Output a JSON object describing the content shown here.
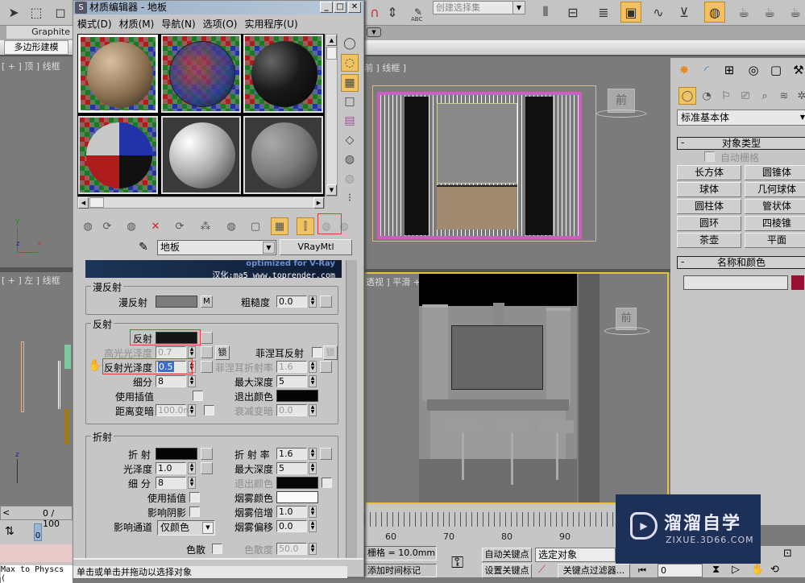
{
  "toolbar": {
    "selection_set_placeholder": "创建选择集",
    "graphite_tab": "Graphite",
    "poly_modeling_tab": "多边形建模",
    "abc_label": "ABC"
  },
  "viewports": {
    "top_label": "[ + ] 顶 ] 线框",
    "left_label": "[ + ] 左 ] 线框",
    "front_label": "前 ] 线框 ]",
    "perspective_label": "透视 ] 平滑 + 高光 ]",
    "viewcube_face": "前",
    "axis_x": "x",
    "axis_y": "y",
    "axis_z": "z"
  },
  "material_editor": {
    "title": "材质编辑器 - 地板",
    "menu": [
      "模式(D)",
      "材质(M)",
      "导航(N)",
      "选项(O)",
      "实用程序(U)"
    ],
    "material_name": "地板",
    "material_type": "VRayMtl",
    "banner_line1": "optimized for V-Ray",
    "banner_line2": "汉化:ma5 www.toprender.com",
    "diffuse": {
      "group_title": "漫反射",
      "diffuse_label": "漫反射",
      "diffuse_color": "#7c7c7c",
      "map_button": "M",
      "roughness_label": "粗糙度",
      "roughness_value": "0.0"
    },
    "reflection": {
      "group_title": "反射",
      "reflect_label": "反射",
      "reflect_color": "#161616",
      "hilight_gloss_label": "高光光泽度",
      "hilight_gloss_value": "0.7",
      "lock_button": "锁",
      "fresnel_label": "菲涅耳反射",
      "fresnel_lock": "锁",
      "refl_gloss_label": "反射光泽度",
      "refl_gloss_value": "0.5",
      "fresnel_ior_label": "菲涅耳折射率",
      "fresnel_ior_value": "1.6",
      "subdivs_label": "细分",
      "subdivs_value": "8",
      "max_depth_label": "最大深度",
      "max_depth_value": "5",
      "use_interp_label": "使用插值",
      "exit_color_label": "退出颜色",
      "exit_color": "#050505",
      "dim_distance_label": "距离变暗",
      "dim_distance_value": "100.0m",
      "dim_falloff_label": "衰减变暗",
      "dim_falloff_value": "0.0"
    },
    "refraction": {
      "group_title": "折射",
      "refract_label": "折 射",
      "refract_color": "#050505",
      "ior_label": "折 射 率",
      "ior_value": "1.6",
      "gloss_label": "光泽度",
      "gloss_value": "1.0",
      "max_depth_label": "最大深度",
      "max_depth_value": "5",
      "subdivs_label": "细 分",
      "subdivs_value": "8",
      "exit_color_label": "退出颜色",
      "exit_color": "#050505",
      "use_interp_label": "使用插值",
      "fog_color_label": "烟雾颜色",
      "fog_color": "#fafafa",
      "affect_shadows_label": "影响阴影",
      "fog_mult_label": "烟雾倍增",
      "fog_mult_value": "1.0",
      "affect_channels_label": "影响通道",
      "affect_channels_value": "仅颜色",
      "fog_bias_label": "烟雾偏移",
      "fog_bias_value": "0.0",
      "dispersion_label": "色散",
      "abbe_label": "色散度",
      "abbe_value": "50.0"
    }
  },
  "command_panel": {
    "category": "标准基本体",
    "object_type_title": "对象类型",
    "autogrid_label": "自动栅格",
    "buttons": [
      "长方体",
      "圆锥体",
      "球体",
      "几何球体",
      "圆柱体",
      "管状体",
      "圆环",
      "四棱锥",
      "茶壶",
      "平面"
    ],
    "name_color_title": "名称和颜色",
    "object_name": "",
    "object_color": "#9a1030"
  },
  "timeline": {
    "frame_counter": "0 / 100",
    "current_frame": "0",
    "ticks": [
      "60",
      "70",
      "80",
      "90"
    ]
  },
  "status": {
    "maxscript": "Max to Physcs (",
    "prompt": "单击或单击并拖动以选择对象",
    "grid": "栅格 = 10.0mm",
    "add_time_tag": "添加时间标记",
    "auto_key": "自动关键点",
    "set_key": "设置关键点",
    "key_mode_value": "选定对象",
    "key_filters": "关键点过滤器...",
    "frame_value": "0"
  },
  "watermark": {
    "title": "溜溜自学",
    "url": "ZIXUE.3D66.COM"
  }
}
